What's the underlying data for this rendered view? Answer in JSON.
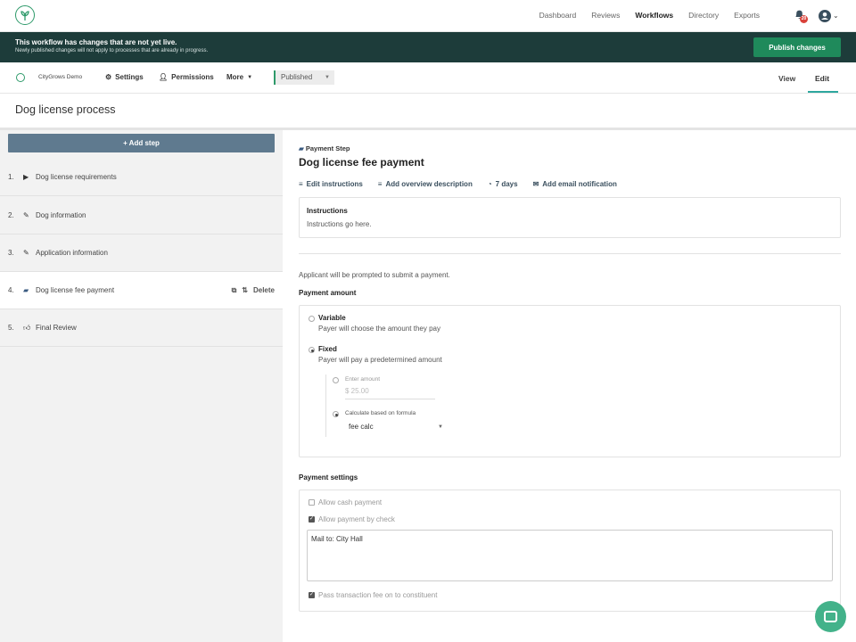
{
  "topnav": {
    "links": [
      "Dashboard",
      "Reviews",
      "Workflows",
      "Directory",
      "Exports"
    ],
    "active": "Workflows",
    "notification_count": "20"
  },
  "banner": {
    "title": "This workflow has changes that are not yet live.",
    "subtitle": "Newly published changes will not apply to processes that are already in progress.",
    "publish_label": "Publish changes"
  },
  "subbar": {
    "org": "CityGrows Demo",
    "settings": "Settings",
    "permissions": "Permissions",
    "more": "More",
    "status": "Published",
    "tab_view": "View",
    "tab_edit": "Edit"
  },
  "process_title": "Dog license process",
  "left": {
    "add_step": "+ Add step",
    "steps": [
      {
        "num": "1.",
        "label": "Dog license requirements",
        "icon": "play-icon"
      },
      {
        "num": "2.",
        "label": "Dog information",
        "icon": "pencil-icon"
      },
      {
        "num": "3.",
        "label": "Application information",
        "icon": "pencil-icon"
      },
      {
        "num": "4.",
        "label": "Dog license fee payment",
        "icon": "money-icon"
      },
      {
        "num": "5.",
        "label": "Final Review",
        "icon": "thumbs-up-icon"
      }
    ],
    "delete_label": "Delete"
  },
  "step": {
    "type": "Payment Step",
    "title": "Dog license fee payment",
    "actions": [
      "Edit instructions",
      "Add overview description",
      "7 days",
      "Add email notification"
    ],
    "instructions_heading": "Instructions",
    "instructions_body": "Instructions go here.",
    "applicant_text": "Applicant will be prompted to submit a payment.",
    "payment_amount_heading": "Payment amount",
    "variable_title": "Variable",
    "variable_desc": "Payer will choose the amount they pay",
    "fixed_title": "Fixed",
    "fixed_desc": "Payer will pay a predetermined amount",
    "enter_amount_label": "Enter amount",
    "amount_placeholder": "$  25.00",
    "formula_label": "Calculate based on formula",
    "formula_value": "fee calc",
    "payment_settings_heading": "Payment settings",
    "allow_cash": "Allow cash payment",
    "allow_check": "Allow payment by check",
    "mail_to": "Mail to: City Hall",
    "pass_fee": "Pass transaction fee on to constituent"
  }
}
